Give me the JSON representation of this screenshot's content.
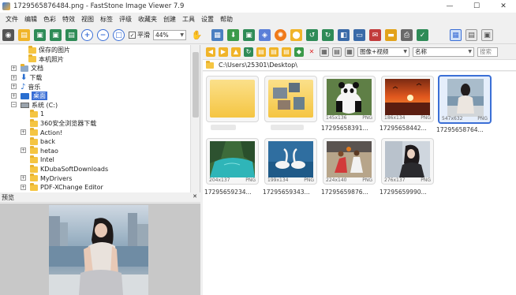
{
  "window": {
    "title": "1729565876484.png - FastStone Image Viewer 7.9",
    "minimize": "—",
    "maximize": "☐",
    "close": "✕"
  },
  "menu": [
    "文件",
    "编辑",
    "色彩",
    "特效",
    "视图",
    "标签",
    "评级",
    "收藏夹",
    "创建",
    "工具",
    "设置",
    "帮助"
  ],
  "toolbar": {
    "smooth_label": "平滑",
    "smooth_checked": "✓",
    "zoom_value": "44%"
  },
  "tree": {
    "items": [
      {
        "label": "保存的图片",
        "type": "folder"
      },
      {
        "label": "本机照片",
        "type": "folder"
      },
      {
        "label": "文档",
        "type": "doc"
      },
      {
        "label": "下载",
        "type": "download"
      },
      {
        "label": "音乐",
        "type": "music"
      },
      {
        "label": "桌面",
        "type": "desktop"
      },
      {
        "label": "系统 (C:)",
        "type": "drive"
      },
      {
        "label": "1",
        "type": "folder"
      },
      {
        "label": "360安全浏览器下载",
        "type": "folder"
      },
      {
        "label": "Action!",
        "type": "folder"
      },
      {
        "label": "back",
        "type": "folder"
      },
      {
        "label": "hetao",
        "type": "folder"
      },
      {
        "label": "Intel",
        "type": "folder"
      },
      {
        "label": "KDubaSoftDownloads",
        "type": "folder"
      },
      {
        "label": "MyDrivers",
        "type": "folder"
      },
      {
        "label": "PDF-XChange Editor",
        "type": "folder"
      }
    ]
  },
  "preview": {
    "label": "预览",
    "close": "✕"
  },
  "browser": {
    "view_mode": "图像+视频",
    "sort_by": "名称",
    "search_placeholder": "搜索",
    "path": "C:\\Users\\25301\\Desktop\\",
    "thumbnails": [
      {
        "name": "",
        "dims": "",
        "format": "",
        "kind": "folder",
        "selected": false
      },
      {
        "name": "",
        "dims": "",
        "format": "",
        "kind": "folder-photos",
        "selected": false
      },
      {
        "name": "17295658391...",
        "dims": "145x136",
        "format": "PNG",
        "kind": "panda",
        "selected": false
      },
      {
        "name": "17295658442...",
        "dims": "186x134",
        "format": "PNG",
        "kind": "sunset",
        "selected": false
      },
      {
        "name": "17295658764...",
        "dims": "547x632",
        "format": "PNG",
        "kind": "woman-city",
        "selected": true
      },
      {
        "name": "17295659234...",
        "dims": "204x137",
        "format": "PNG",
        "kind": "lake",
        "selected": false
      },
      {
        "name": "17295659343...",
        "dims": "199x134",
        "format": "PNG",
        "kind": "swans",
        "selected": false
      },
      {
        "name": "17295659876...",
        "dims": "224x140",
        "format": "PNG",
        "kind": "basketball",
        "selected": false
      },
      {
        "name": "17295659990...",
        "dims": "276x137",
        "format": "PNG",
        "kind": "woman-dark",
        "selected": false
      }
    ]
  },
  "colors": {
    "accent": "#3b6fd6",
    "folder": "#f5c542",
    "selected_bg": "#e5eefb"
  }
}
